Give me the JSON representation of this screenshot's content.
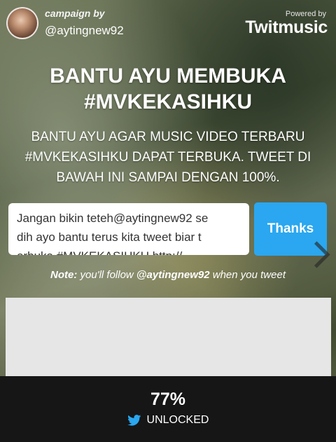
{
  "header": {
    "campaign_by": "campaign by",
    "handle": "@aytingnew92",
    "powered_by": "Powered by",
    "brand": "Twitmusic"
  },
  "campaign": {
    "title_line1": "BANTU AYU MEMBUKA",
    "title_line2": "#MVKEKASIHKU",
    "description_line1": "BANTU AYU AGAR MUSIC VIDEO TERBARU",
    "description_line2": "#MVKEKASIHKU DAPAT TERBUKA. TWEET DI",
    "description_line3": "BAWAH INI SAMPAI DENGAN 100%."
  },
  "tweet": {
    "line1": "Jangan bikin teteh@aytingnew92 se",
    "line2": "dih ayo bantu terus kita tweet biar t",
    "line3": "erbuka #MVKEKASIHKU http://",
    "button_label": "Thanks"
  },
  "note": {
    "label": "Note:",
    "text_before": "you'll follow",
    "handle": "@aytingnew92",
    "text_after": "when you tweet"
  },
  "progress": {
    "percent": "77%",
    "status": "UNLOCKED"
  },
  "colors": {
    "accent": "#2aa7f0",
    "footer": "#161616",
    "panel": "#e6e6e6"
  }
}
